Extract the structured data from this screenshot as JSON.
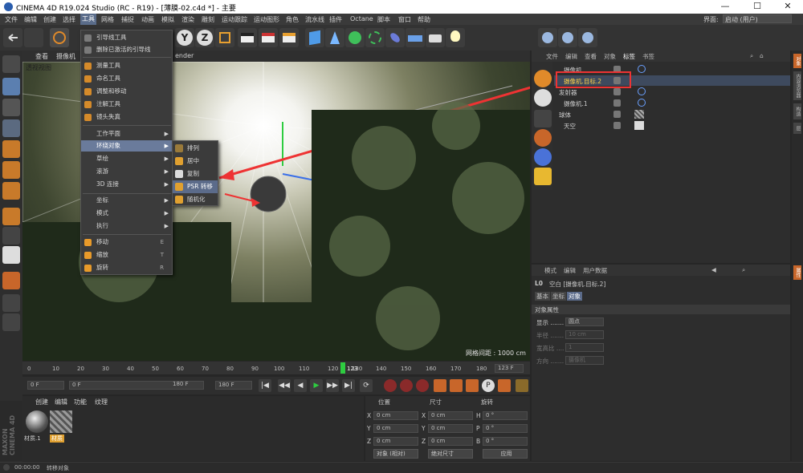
{
  "window": {
    "title": "CINEMA 4D R19.024 Studio (RC - R19) - [薄膜-02.c4d *] - 主要",
    "min": "—",
    "max": "☐",
    "close": "✕"
  },
  "menubar": [
    "文件",
    "编辑",
    "创建",
    "选择",
    "工具",
    "网格",
    "捕捉",
    "动画",
    "模拟",
    "渲染",
    "雕刻",
    "运动跟踪",
    "运动图形",
    "角色",
    "流水线",
    "插件",
    "Octane",
    "脚本",
    "窗口",
    "帮助"
  ],
  "interface": {
    "label": "界面:",
    "value": "启动 (用户)"
  },
  "viewport": {
    "tabs": [
      "查看",
      "摄像机",
      "..."
    ],
    "render_label": "ender",
    "view_name": "透视视图",
    "grid_spacing": "网格间距 : 1000 cm"
  },
  "tools_menu": {
    "items": [
      {
        "label": "引导线工具",
        "icon_color": "#7a7a7a"
      },
      {
        "label": "删除已激活的引导线",
        "icon_color": "#7a7a7a"
      },
      {
        "label": "测量工具",
        "icon_color": "#d58a2a"
      },
      {
        "label": "命名工具",
        "icon_color": "#d58a2a"
      },
      {
        "label": "调整和移动",
        "icon_color": "#d58a2a"
      },
      {
        "label": "注解工具",
        "icon_color": "#d58a2a"
      },
      {
        "label": "镜头失真",
        "icon_color": "#d58a2a"
      },
      {
        "label": "工作平面",
        "arrow": "▶"
      },
      {
        "label": "环绕对象",
        "arrow": "▶",
        "highlighted": true
      },
      {
        "label": "草绘",
        "arrow": "▶"
      },
      {
        "label": "滚游",
        "arrow": "▶"
      },
      {
        "label": "3D 连接",
        "arrow": "▶"
      },
      {
        "label": "坐标",
        "arrow": "▶"
      },
      {
        "label": "模式",
        "arrow": "▶"
      },
      {
        "label": "执行",
        "arrow": "▶"
      },
      {
        "label": "移动",
        "key": "E",
        "icon_color": "#e89a2a"
      },
      {
        "label": "缩放",
        "key": "T",
        "icon_color": "#e89a2a"
      },
      {
        "label": "旋转",
        "key": "R",
        "icon_color": "#e89a2a"
      }
    ]
  },
  "submenu": {
    "items": [
      {
        "label": "排列",
        "icon_color": "#9a7a3a"
      },
      {
        "label": "居中",
        "icon_color": "#e0a030"
      },
      {
        "label": "复制",
        "icon_color": "#dcdcdc"
      },
      {
        "label": "PSR 转移",
        "icon_color": "#e0a030",
        "highlighted": true
      },
      {
        "label": "随机化",
        "icon_color": "#e0a030"
      }
    ]
  },
  "object_manager": {
    "tabs": [
      "文件",
      "编辑",
      "查看",
      "对象",
      "标签",
      "书签"
    ],
    "rows": [
      {
        "name": "摄像机",
        "indent": 10
      },
      {
        "name": "摄像机.目标.2",
        "indent": 10,
        "selected": true
      },
      {
        "name": "发射器",
        "indent": 4
      },
      {
        "name": "摄像机.1",
        "indent": 10
      },
      {
        "name": "球体",
        "indent": 4
      },
      {
        "name": "天空",
        "indent": 10
      }
    ]
  },
  "attribute_manager": {
    "tabs": [
      "模式",
      "编辑",
      "用户数据"
    ],
    "object_title": "空白 [摄像机.目标.2]",
    "subtabs": [
      "基本",
      "坐标",
      "对象"
    ],
    "section": "对象属性",
    "fields": [
      {
        "label": "显示 .......",
        "value": "圆点",
        "dim": false
      },
      {
        "label": "半径 .......",
        "value": "10 cm",
        "dim": true
      },
      {
        "label": "宽高比 ....",
        "value": "1",
        "dim": true
      },
      {
        "label": "方向 .......",
        "value": "摄像机",
        "dim": true
      }
    ]
  },
  "timeline": {
    "ticks": [
      "0",
      "10",
      "20",
      "30",
      "40",
      "50",
      "60",
      "70",
      "80",
      "90",
      "100",
      "110",
      "120",
      "130",
      "140",
      "150",
      "160",
      "170",
      "180"
    ],
    "current_frame_marker": "123",
    "current_frame": "123 F"
  },
  "playback": {
    "start": "0 F",
    "current": "0 F",
    "end_field": "180 F",
    "end": "180 F",
    "buttons": [
      "|◀",
      "◀◀",
      "◀",
      "▶",
      "▶▶",
      "▶|",
      "⟳"
    ]
  },
  "material_manager": {
    "tabs": [
      "创建",
      "编辑",
      "功能",
      "纹理"
    ],
    "materials": [
      {
        "name": "材质.1"
      },
      {
        "name": "材质",
        "selected": true
      }
    ]
  },
  "coord_manager": {
    "headers": [
      "位置",
      "尺寸",
      "旋转"
    ],
    "rows": [
      {
        "axis": "X",
        "pos": "0 cm",
        "size_axis": "X",
        "size": "0 cm",
        "rot_axis": "H",
        "rot": "0 °"
      },
      {
        "axis": "Y",
        "pos": "0 cm",
        "size_axis": "Y",
        "size": "0 cm",
        "rot_axis": "P",
        "rot": "0 °"
      },
      {
        "axis": "Z",
        "pos": "0 cm",
        "size_axis": "Z",
        "size": "0 cm",
        "rot_axis": "B",
        "rot": "0 °"
      }
    ],
    "mode1": "对象 (相对)",
    "mode2": "绝对尺寸",
    "apply": "应用"
  },
  "side_tabs": [
    "对象",
    "内容浏览器",
    "构造",
    "层"
  ],
  "attr_side_tab": "属性",
  "status": {
    "time": "00:00:00",
    "message": "转移对象"
  },
  "brand": "MAXON CINEMA 4D"
}
